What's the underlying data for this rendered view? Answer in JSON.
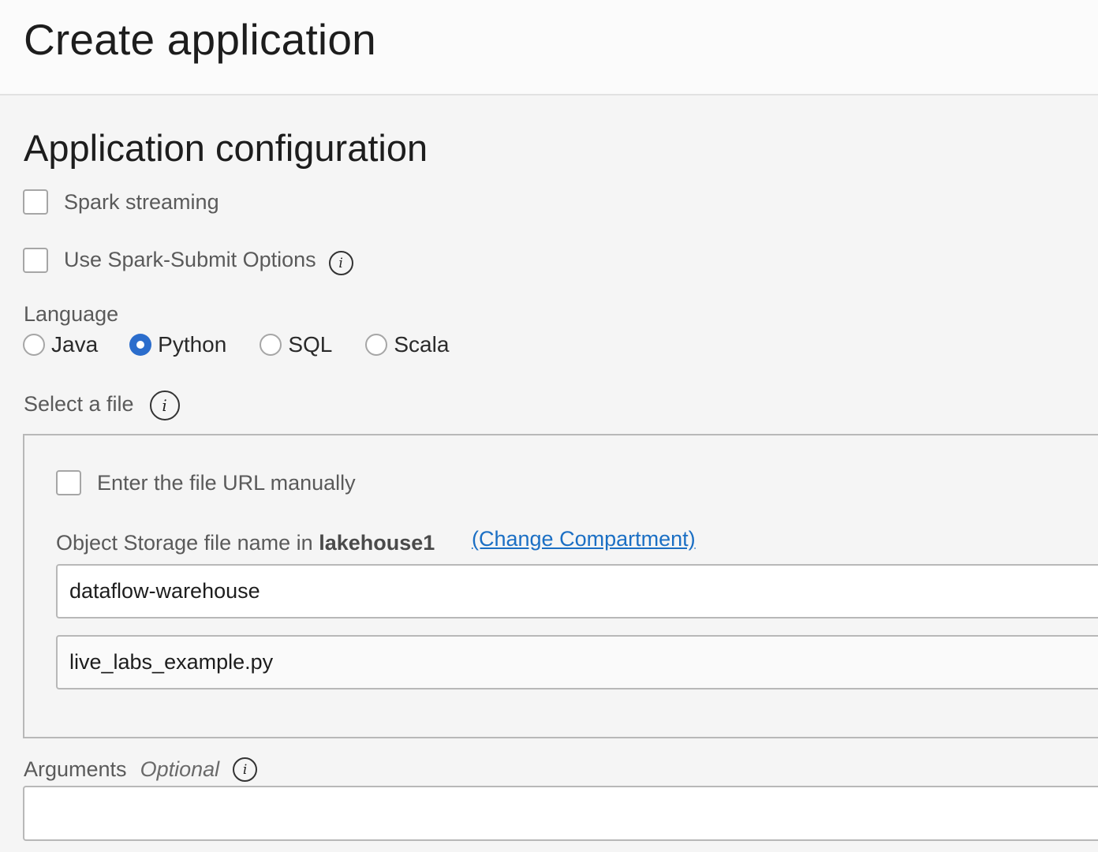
{
  "header": {
    "title": "Create application"
  },
  "section": {
    "title": "Application configuration"
  },
  "spark_streaming": {
    "label": "Spark streaming",
    "checked": false
  },
  "spark_submit": {
    "label": "Use Spark-Submit Options",
    "checked": false,
    "info_icon": "info-icon"
  },
  "language": {
    "label": "Language",
    "options": [
      {
        "label": "Java",
        "selected": false
      },
      {
        "label": "Python",
        "selected": true
      },
      {
        "label": "SQL",
        "selected": false
      },
      {
        "label": "Scala",
        "selected": false
      }
    ]
  },
  "select_file": {
    "label": "Select a file",
    "info_icon": "info-icon",
    "manual_url": {
      "label": "Enter the file URL manually",
      "checked": false
    },
    "storage_label_prefix": "Object Storage file name in",
    "compartment": "lakehouse1",
    "change_link": "(Change Compartment)",
    "bucket_value": "dataflow-warehouse",
    "file_value": "live_labs_example.py"
  },
  "arguments": {
    "label": "Arguments",
    "optional": "Optional",
    "info_icon": "info-icon",
    "value": ""
  },
  "icon_glyph": "i",
  "colors": {
    "accent": "#2b6dcc",
    "link": "#1b6fc4",
    "label_text": "#5a5a5a",
    "border": "#b8b8b8",
    "background": "#f5f5f5"
  }
}
